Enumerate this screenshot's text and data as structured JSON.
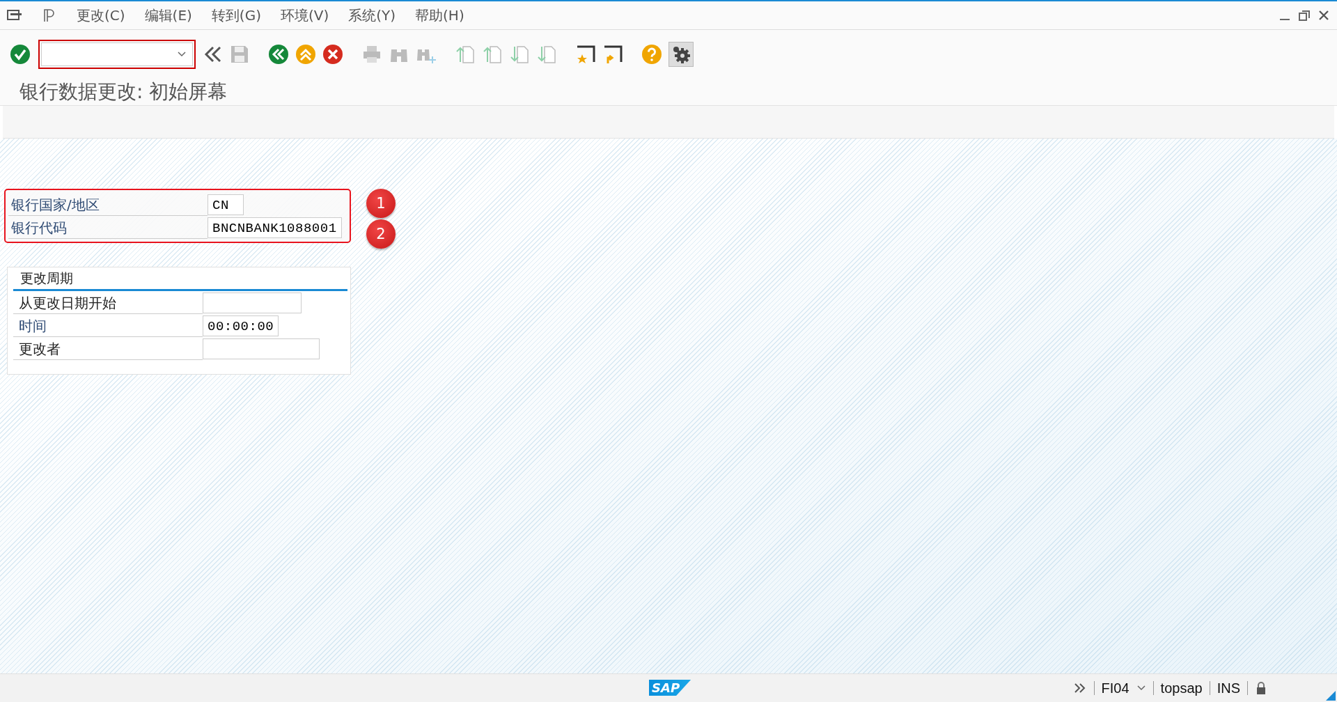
{
  "menu_bar": {
    "items": [
      "更改(C)",
      "编辑(E)",
      "转到(G)",
      "环境(V)",
      "系统(Y)",
      "帮助(H)"
    ]
  },
  "title": "银行数据更改: 初始屏幕",
  "key_fields": [
    {
      "label": "银行国家/地区",
      "value": "CN",
      "marker": "1"
    },
    {
      "label": "银行代码",
      "value": "BNCNBANK1088001",
      "marker": "2"
    }
  ],
  "group": {
    "title": "更改周期",
    "fields": [
      {
        "label": "从更改日期开始"
      },
      {
        "label": "时间",
        "value": "00:00:00"
      },
      {
        "label": "更改者"
      }
    ]
  },
  "status_bar": {
    "logo": "SAP",
    "transaction": "FI04",
    "user": "topsap",
    "mode": "INS"
  }
}
